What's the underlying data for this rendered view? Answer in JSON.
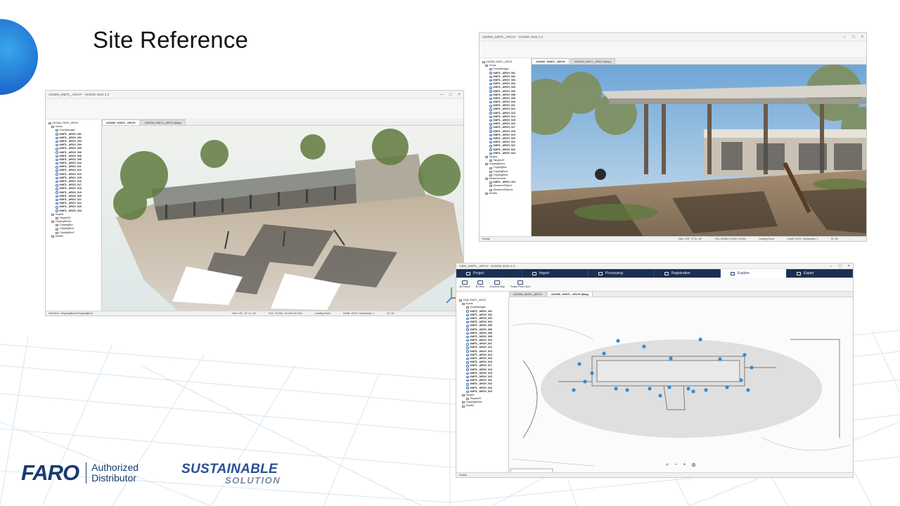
{
  "slide": {
    "title": "Site Reference"
  },
  "windows": {
    "cloud": {
      "title": "240306_KMITL_ARCH* - SCENE 2024.1.0",
      "tabs": [
        "240306_KMITL_ARCH",
        "240306_KMITL_ARCH (Map)"
      ],
      "tree": [
        "240306_KMITL_ARCH",
        "Scans",
        "ScanManager",
        "KMITL_ARCH_001",
        "KMITL_ARCH_002",
        "KMITL_ARCH_003",
        "KMITL_ARCH_004",
        "KMITL_ARCH_005",
        "KMITL_ARCH_006",
        "KMITL_ARCH_008",
        "KMITL_ARCH_009",
        "KMITL_ARCH_010",
        "KMITL_ARCH_011",
        "KMITL_ARCH_013",
        "KMITL_ARCH_014",
        "KMITL_ARCH_015",
        "KMITL_ARCH_016",
        "KMITL_ARCH_017",
        "KMITL_ARCH_018",
        "KMITL_ARCH_019",
        "KMITL_ARCH_020",
        "KMITL_ARCH_021",
        "KMITL_ARCH_022",
        "KMITL_ARCH_023",
        "KMITL_ARCH_024",
        "Targets",
        "Targets29",
        "ClippingBoxes",
        "ClippingBox",
        "ClippingBox1",
        "ClippingBox2",
        "Models"
      ],
      "status": {
        "selection": "Selection: /ClippingBoxes/ClippingBox2",
        "view": "View: 28° -10° to -16°",
        "pos": "Pos: 75.25m -23.09m 32.23m",
        "loading": "Loading Done",
        "detail": "Detail: 100%, Subsample: 1",
        "fps": "Fk: 90"
      }
    },
    "photo": {
      "title": "240306_KMITL_ARCH* - SCENE 2024.1.0",
      "tabs": [
        "240306_KMITL_ARCH",
        "240306_KMITL_ARCH (Map)"
      ],
      "tree": [
        "240306_KMITL_ARCH",
        "Scans",
        "ScanManager",
        "KMITL_ARCH_001",
        "KMITL_ARCH_002",
        "KMITL_ARCH_003",
        "KMITL_ARCH_004",
        "KMITL_ARCH_005",
        "KMITL_ARCH_006",
        "KMITL_ARCH_008",
        "KMITL_ARCH_009",
        "KMITL_ARCH_010",
        "KMITL_ARCH_011",
        "KMITL_ARCH_012",
        "KMITL_ARCH_013",
        "KMITL_ARCH_014",
        "KMITL_ARCH_015",
        "KMITL_ARCH_016",
        "KMITL_ARCH_017",
        "KMITL_ARCH_018",
        "KMITL_ARCH_019",
        "KMITL_ARCH_020",
        "KMITL_ARCH_021",
        "KMITL_ARCH_022",
        "KMITL_ARCH_023",
        "KMITL_ARCH_024",
        "Targets",
        "Targets29",
        "ClippingBoxes",
        "ClippingBox",
        "ClippingBox1",
        "ClippingBox2",
        "Measurements",
        "KMITL_ARCH_013",
        "MeasuredObject",
        "MeasuredObject1",
        "Models"
      ],
      "status": {
        "selection": "Ready",
        "view": "View: 193° -5° to -16°",
        "pos": "Pos: 86.86m 3.25m 76.04m",
        "loading": "Loading Done",
        "detail": "Detail: 100%, Subsample: 1",
        "fps": "Fk: 50"
      }
    },
    "map": {
      "title": "1306_KMITL_ARCH - SCENE 2024.1.0",
      "ribbon_tabs": [
        "Project",
        "Import",
        "Processing",
        "Registration",
        "Explore",
        "Export"
      ],
      "active_tab": "Explore",
      "tools": [
        "3D Project",
        "3D View",
        "Overview Map",
        "Project Point Cloud"
      ],
      "tabs": [
        "240306_KMITL_ARCH",
        "240306_KMITL_ARCH (Map)"
      ],
      "tree": [
        "1306_KMITL_ARCH",
        "Scans",
        "ScanManager",
        "KMITL_ARCH_001",
        "KMITL_ARCH_002",
        "KMITL_ARCH_003",
        "KMITL_ARCH_004",
        "KMITL_ARCH_005",
        "KMITL_ARCH_006",
        "KMITL_ARCH_008",
        "KMITL_ARCH_009",
        "KMITL_ARCH_010",
        "KMITL_ARCH_011",
        "KMITL_ARCH_012",
        "KMITL_ARCH_013",
        "KMITL_ARCH_014",
        "KMITL_ARCH_015",
        "KMITL_ARCH_016",
        "KMITL_ARCH_017",
        "KMITL_ARCH_018",
        "KMITL_ARCH_019",
        "KMITL_ARCH_020",
        "KMITL_ARCH_021",
        "KMITL_ARCH_022",
        "KMITL_ARCH_023",
        "KMITL_ARCH_024",
        "Targets",
        "Targets29",
        "ClippingBoxes",
        "Models"
      ],
      "status": "Ready",
      "zoom_controls": [
        "search",
        "zoom-out",
        "zoom-in",
        "settings"
      ]
    }
  },
  "logos": {
    "faro": "FARO",
    "faro_sub_1": "Authorized",
    "faro_sub_2": "Distributor",
    "sustain_1": "SUSTAINABLE",
    "sustain_2": "SOLUTION"
  },
  "colors": {
    "accent": "#1f6fd0",
    "ribbon": "#1b2f52",
    "scan_marker": "#2f8fd8"
  }
}
